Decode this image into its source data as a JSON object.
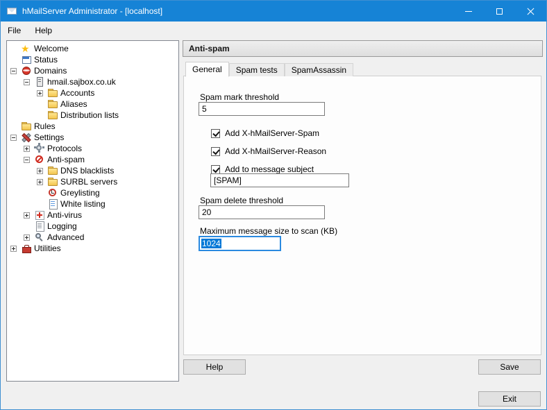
{
  "window": {
    "title": "hMailServer Administrator - [localhost]"
  },
  "menubar": {
    "items": [
      {
        "label": "File"
      },
      {
        "label": "Help"
      }
    ]
  },
  "sidebar": {
    "items": [
      {
        "label": "Welcome",
        "icon": "star",
        "expander": "none"
      },
      {
        "label": "Status",
        "icon": "status",
        "expander": "none"
      },
      {
        "label": "Domains",
        "icon": "globe",
        "expander": "minus"
      },
      {
        "label": "hmail.sajbox.co.uk",
        "icon": "server",
        "expander": "minus"
      },
      {
        "label": "Accounts",
        "icon": "folder",
        "expander": "plus"
      },
      {
        "label": "Aliases",
        "icon": "folder",
        "expander": "none"
      },
      {
        "label": "Distribution lists",
        "icon": "folder",
        "expander": "none"
      },
      {
        "label": "Rules",
        "icon": "folder",
        "expander": "none"
      },
      {
        "label": "Settings",
        "icon": "tools",
        "expander": "minus"
      },
      {
        "label": "Protocols",
        "icon": "gear",
        "expander": "plus"
      },
      {
        "label": "Anti-spam",
        "icon": "no-entry",
        "expander": "minus"
      },
      {
        "label": "DNS blacklists",
        "icon": "folder",
        "expander": "plus"
      },
      {
        "label": "SURBL servers",
        "icon": "folder",
        "expander": "plus"
      },
      {
        "label": "Greylisting",
        "icon": "clock",
        "expander": "none"
      },
      {
        "label": "White listing",
        "icon": "list",
        "expander": "none"
      },
      {
        "label": "Anti-virus",
        "icon": "first-aid",
        "expander": "plus"
      },
      {
        "label": "Logging",
        "icon": "document",
        "expander": "none"
      },
      {
        "label": "Advanced",
        "icon": "magnifier",
        "expander": "plus"
      },
      {
        "label": "Utilities",
        "icon": "toolbox",
        "expander": "plus"
      }
    ]
  },
  "main": {
    "header_title": "Anti-spam",
    "tabs": [
      {
        "label": "General",
        "active": true
      },
      {
        "label": "Spam tests",
        "active": false
      },
      {
        "label": "SpamAssassin",
        "active": false
      }
    ],
    "form": {
      "spam_mark_threshold": {
        "label": "Spam mark threshold",
        "value": "5"
      },
      "checkboxes": [
        {
          "label": "Add X-hMailServer-Spam",
          "checked": true
        },
        {
          "label": "Add X-hMailServer-Reason",
          "checked": true
        },
        {
          "label": "Add to message subject",
          "checked": true
        }
      ],
      "subject": {
        "value": "[SPAM]"
      },
      "spam_delete_threshold": {
        "label": "Spam delete threshold",
        "value": "20"
      },
      "max_scan_size": {
        "label": "Maximum message size to scan (KB)",
        "value": "1024",
        "selected": true
      }
    },
    "buttons": {
      "help": "Help",
      "save": "Save",
      "exit": "Exit"
    }
  },
  "colors": {
    "titlebar_blue": "#1683d6",
    "focus_blue": "#0078d7"
  }
}
